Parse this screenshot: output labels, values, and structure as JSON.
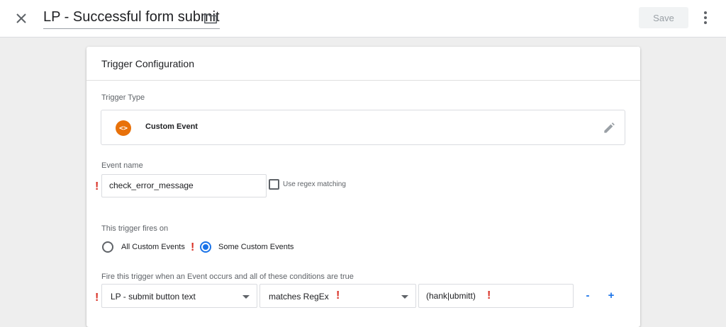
{
  "header": {
    "title": "LP - Successful form submit",
    "save_label": "Save"
  },
  "card": {
    "title": "Trigger Configuration",
    "trigger_type_label": "Trigger Type",
    "trigger_type": {
      "name": "Custom Event",
      "icon_glyph": "<>",
      "icon_color": "#e8710a"
    },
    "event_name_label": "Event name",
    "event_name_value": "check_error_message",
    "regex_label": "Use regex matching",
    "fires_on_label": "This trigger fires on",
    "fires_on_options": [
      {
        "label": "All Custom Events",
        "selected": false
      },
      {
        "label": "Some Custom Events",
        "selected": true
      }
    ],
    "conditions_label": "Fire this trigger when an Event occurs and all of these conditions are true",
    "condition": {
      "variable": "LP - submit button text",
      "operator": "matches RegEx",
      "value": "(hank|ubmitt)"
    },
    "remove_label": "-",
    "add_label": "+",
    "error_mark": "!"
  },
  "colors": {
    "accent": "#1a73e8",
    "error": "#d93025",
    "icon_orange": "#e8710a"
  }
}
